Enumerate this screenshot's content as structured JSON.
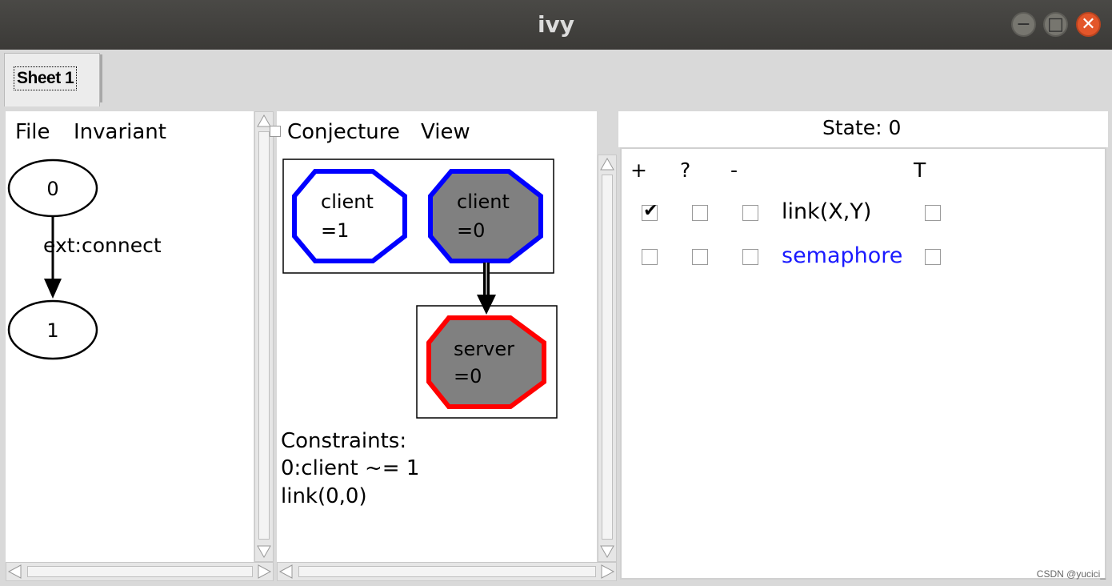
{
  "window": {
    "title": "ivy"
  },
  "tabs": [
    {
      "label": "Sheet 1"
    }
  ],
  "left_panel": {
    "menu": [
      "File",
      "Invariant"
    ],
    "graph": {
      "nodes": [
        "0",
        "1"
      ],
      "edge_label": "ext:connect"
    }
  },
  "middle_panel": {
    "menu": [
      "Conjecture",
      "View"
    ],
    "nodes": [
      {
        "line1": "client",
        "line2": "=1",
        "border": "#0000ff",
        "fill": "#ffffff"
      },
      {
        "line1": "client",
        "line2": "=0",
        "border": "#0000ff",
        "fill": "#808080"
      },
      {
        "line1": "server",
        "line2": "=0",
        "border": "#ff0000",
        "fill": "#808080"
      }
    ],
    "constraints": {
      "heading": "Constraints:",
      "lines": [
        "0:client ~= 1",
        "link(0,0)"
      ]
    }
  },
  "right_panel": {
    "state": "State: 0",
    "headers": {
      "plus": "+",
      "question": "?",
      "minus": "-",
      "t": "T"
    },
    "rows": [
      {
        "label": "link(X,Y)",
        "color": "#000000",
        "plus": true,
        "question": false,
        "minus": false,
        "t": false
      },
      {
        "label": "semaphore",
        "color": "#1a1aff",
        "plus": false,
        "question": false,
        "minus": false,
        "t": false
      }
    ]
  },
  "footer": {
    "credit": "CSDN @yucici_"
  },
  "icons": {
    "minimize": "−",
    "maximize": "□",
    "close": "✕",
    "check": "✔"
  }
}
